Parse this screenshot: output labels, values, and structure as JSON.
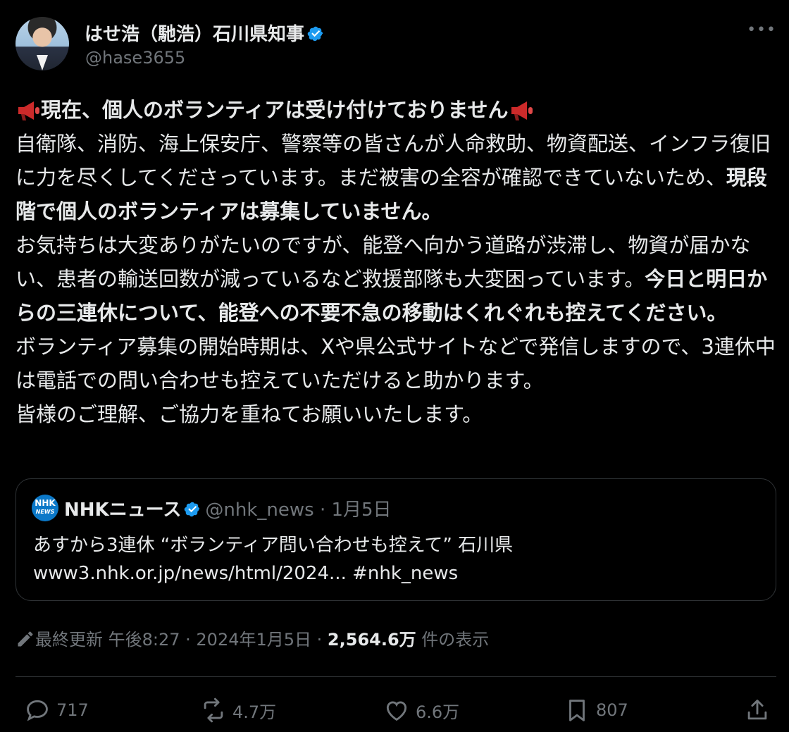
{
  "author": {
    "name": "はせ浩（馳浩）石川県知事",
    "handle": "@hase3655",
    "more_label": "•••"
  },
  "tweet": {
    "headline": "現在、個人のボランティアは受け付けておりません",
    "p1": "自衛隊、消防、海上保安庁、警察等の皆さんが人命救助、物資配送、インフラ復旧に力を尽くしてくださっています。まだ被害の全容が確認できていないため、",
    "p1_bold": "現段階で個人のボランティアは募集していません。",
    "p2": "お気持ちは大変ありがたいのですが、能登へ向かう道路が渋滞し、物資が届かない、患者の輸送回数が減っているなど救援部隊も大変困っています。",
    "p2_bold": "今日と明日からの三連休について、能登への不要不急の移動はくれぐれも控えてください。",
    "p3": "ボランティア募集の開始時期は、Xや県公式サイトなどで発信しますので、3連休中は電話での問い合わせも控えていただけると助かります。",
    "p4": "皆様のご理解、ご協力を重ねてお願いいたします。"
  },
  "quote": {
    "logo_top": "NHK",
    "logo_bottom": "NEWS",
    "name": "NHKニュース",
    "handle": "@nhk_news · 1月5日",
    "line1": "あすから3連休 “ボランティア問い合わせも控えて” 石川県",
    "line2": "www3.nhk.or.jp/news/html/2024... #nhk_news"
  },
  "meta": {
    "edited": "最終更新 午後8:27 · 2024年1月5日 · ",
    "views": "2,564.6万",
    "views_suffix": " 件の表示"
  },
  "actions": {
    "replies": "717",
    "reposts": "4.7万",
    "likes": "6.6万",
    "bookmarks": "807"
  },
  "colors": {
    "background": "#000000",
    "text": "#e7e9ea",
    "muted": "#71767b",
    "verified": "#1d9bf0",
    "border": "#2f3336"
  }
}
